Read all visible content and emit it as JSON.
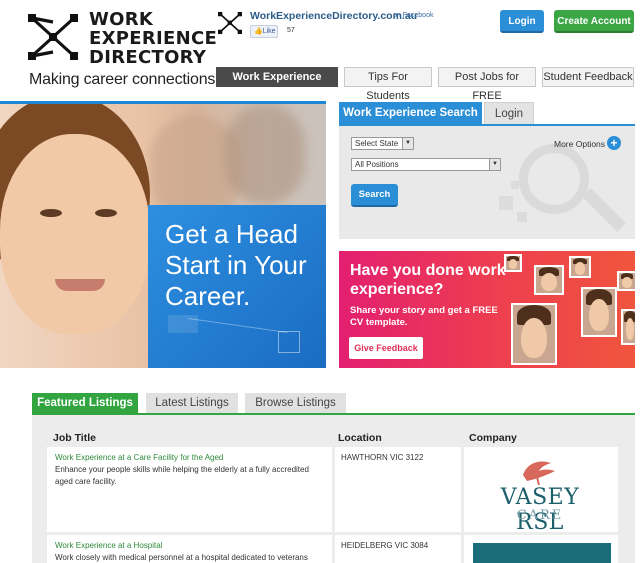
{
  "brand": {
    "logo_lines": [
      "WORK",
      "EXPERIENCE",
      "DIRECTORY"
    ],
    "tagline": "Making career connections."
  },
  "facebook": {
    "site": "WorkExperienceDirectory.com.au",
    "on": "on Facebook",
    "like_label": "Like",
    "like_count": "57"
  },
  "header": {
    "login_label": "Login",
    "create_account_label": "Create Account"
  },
  "nav": {
    "tabs": [
      {
        "label": "Work Experience Search"
      },
      {
        "label": "Tips For Students"
      },
      {
        "label": "Post Jobs for FREE"
      },
      {
        "label": "Student Feedback"
      }
    ]
  },
  "hero": {
    "headline": "Get a Head Start in Your Career."
  },
  "search": {
    "tab_search": "Work Experience Search",
    "tab_login": "Login",
    "state_select": "Select State",
    "positions_select": "All Positions",
    "more_options": "More Options",
    "button": "Search"
  },
  "promo": {
    "title": "Have you done work experience?",
    "subtitle": "Share your story and get a FREE CV template.",
    "button": "Give Feedback"
  },
  "listings": {
    "tabs": [
      "Featured Listings",
      "Latest Listings",
      "Browse Listings"
    ],
    "columns": [
      "Job Title",
      "Location",
      "Company"
    ],
    "rows": [
      {
        "title": "Work Experience at a Care Facility for the Aged",
        "description": "Enhance your people skills while helping the elderly at a fully accredited aged care facility.",
        "location": "HAWTHORN VIC 3122",
        "company_logo_name": "VASEY RSL",
        "company_logo_sub": "CARE"
      },
      {
        "title": "Work Experience at a Hospital",
        "description": "Work closely with medical personnel at a hospital dedicated to veterans",
        "location": "HEIDELBERG VIC 3084"
      }
    ]
  },
  "colors": {
    "brand_blue": "#2b8fd8",
    "brand_green": "#3aa644",
    "promo_pink": "#e31f70",
    "nav_active": "#4a4a4a"
  }
}
